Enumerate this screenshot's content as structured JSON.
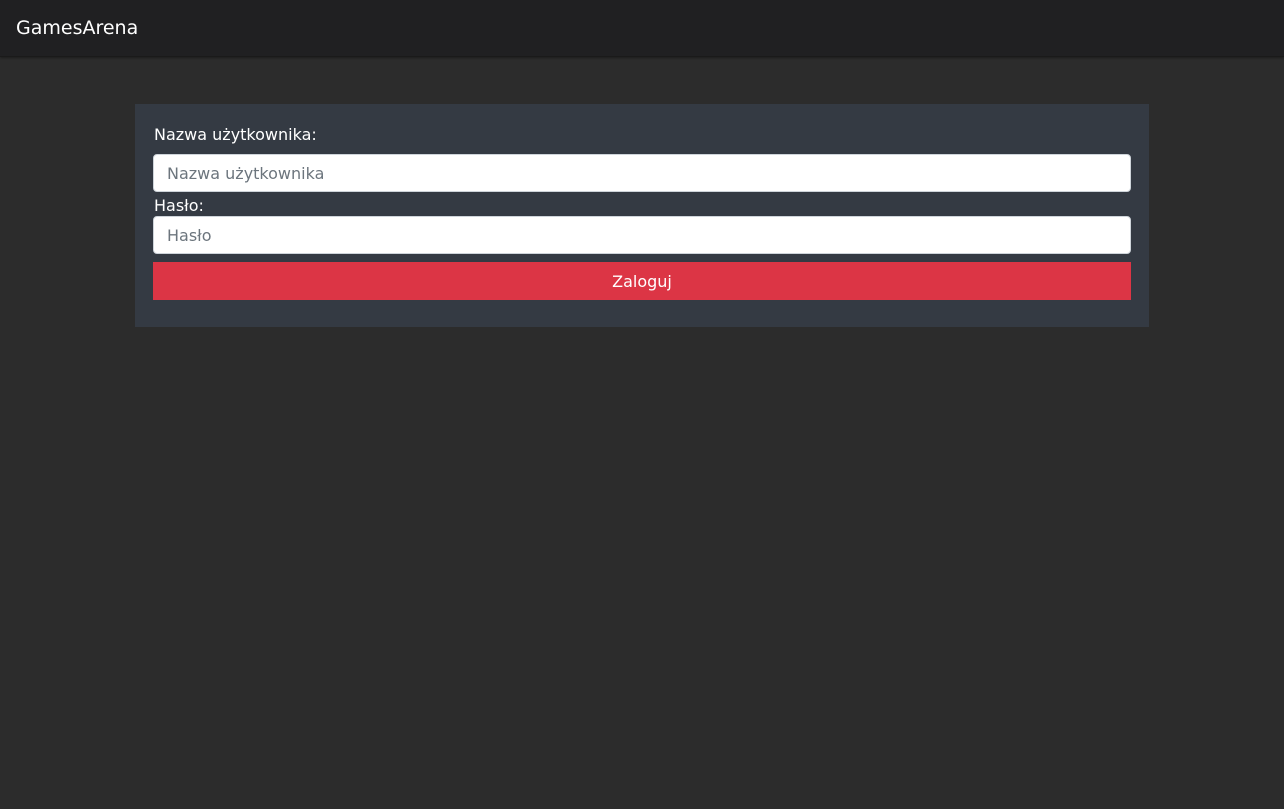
{
  "navbar": {
    "brand": "GamesArena"
  },
  "login_form": {
    "username_label": "Nazwa użytkownika:",
    "username_placeholder": "Nazwa użytkownika",
    "username_value": "",
    "password_label": "Hasło:",
    "password_placeholder": "Hasło",
    "password_value": "",
    "submit_label": "Zaloguj"
  },
  "colors": {
    "page_background": "#2c2c2c",
    "navbar_background": "#202022",
    "card_background": "#343a43",
    "button_accent": "#dc3545"
  }
}
